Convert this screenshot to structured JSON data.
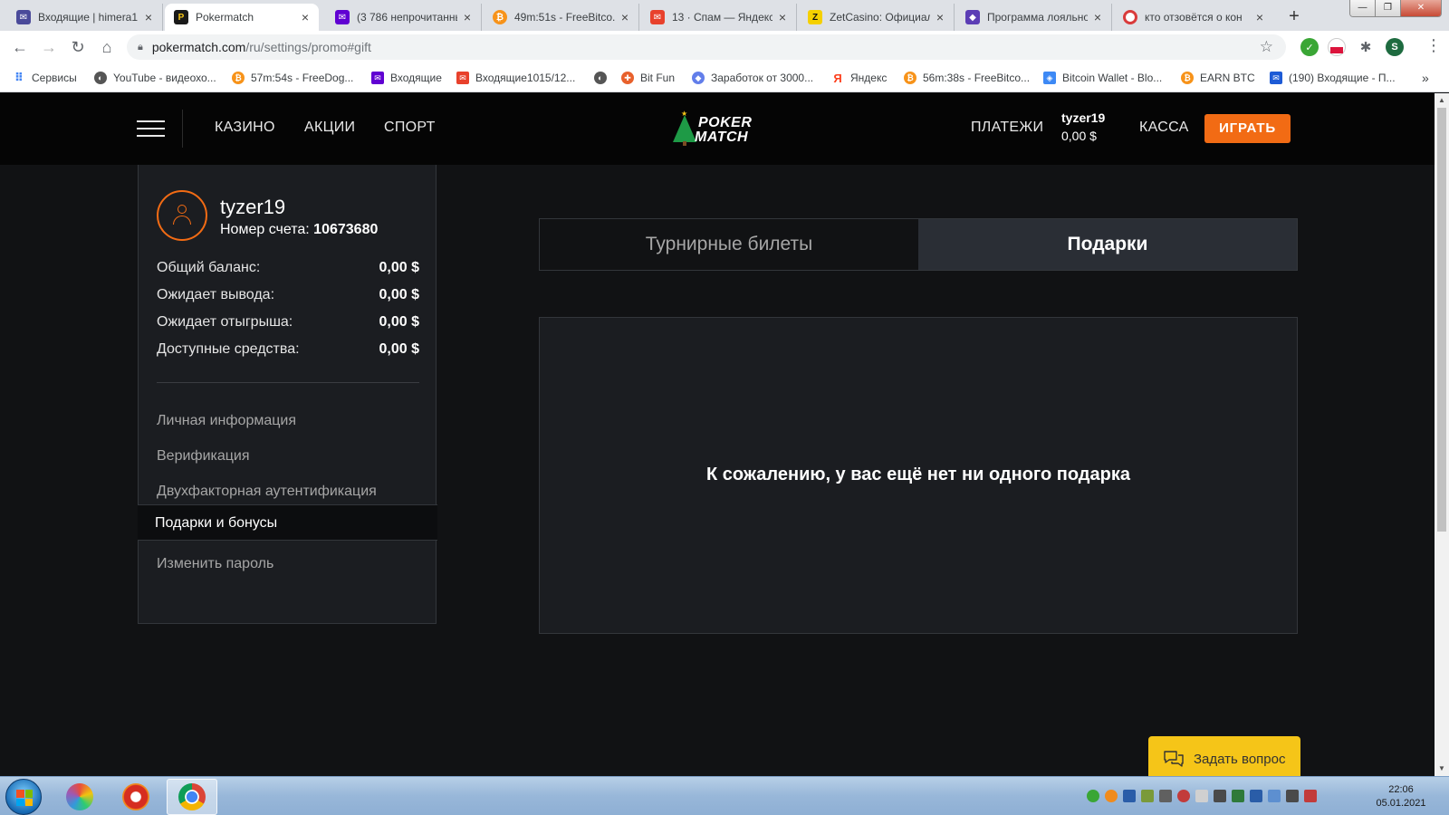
{
  "browser": {
    "tabs": [
      {
        "title": "Входящие | himera1",
        "icon": "mail-icon",
        "color": "#4a4a9a",
        "active": false
      },
      {
        "title": "Pokermatch",
        "icon": "pokermatch-icon",
        "color": "#f5c518",
        "active": true
      },
      {
        "title": "(3 786 непрочитанных",
        "icon": "yahoo-mail-icon",
        "color": "#6001d2",
        "active": false
      },
      {
        "title": "49m:51s - FreeBitco.i",
        "icon": "bitcoin-icon",
        "color": "#f7931a",
        "active": false
      },
      {
        "title": "13 · Спам — Яндекс",
        "icon": "yandex-mail-icon",
        "color": "#e8412c",
        "active": false
      },
      {
        "title": "ZetCasino: Официал",
        "icon": "zetcasino-icon",
        "color": "#f5d000",
        "active": false
      },
      {
        "title": "Программа лояльно",
        "icon": "layers-icon",
        "color": "#5b3db5",
        "active": false
      },
      {
        "title": "кто отзовётся о кон",
        "icon": "lifebuoy-icon",
        "color": "#d93b3b",
        "active": false
      }
    ],
    "new_tab": "+",
    "url_host": "pokermatch.com",
    "url_path": "/ru/settings/promo#gift",
    "profile_initial": "S",
    "bookmarks": [
      {
        "label": "Сервисы",
        "icon": "apps-grid-icon",
        "color": "#4285f4"
      },
      {
        "label": "YouTube - видеохо...",
        "icon": "globe-icon",
        "color": "#555555"
      },
      {
        "label": "57m:54s - FreeDog...",
        "icon": "bitcoin-icon",
        "color": "#f7931a"
      },
      {
        "label": "Входящие",
        "icon": "yahoo-mail-icon",
        "color": "#6001d2"
      },
      {
        "label": "Входящие1015/12...",
        "icon": "yandex-mail-icon",
        "color": "#e8412c"
      },
      {
        "label": "",
        "icon": "globe-icon",
        "color": "#555555"
      },
      {
        "label": "Bit Fun",
        "icon": "bitfun-icon",
        "color": "#e8612c"
      },
      {
        "label": "Заработок от 3000...",
        "icon": "ethereum-icon",
        "color": "#627eea"
      },
      {
        "label": "Яндекс",
        "icon": "yandex-icon",
        "color": "#fc3f1d"
      },
      {
        "label": "56m:38s - FreeBitco...",
        "icon": "bitcoin-icon",
        "color": "#f7931a"
      },
      {
        "label": "Bitcoin Wallet - Blo...",
        "icon": "blockchain-icon",
        "color": "#3d89f5"
      },
      {
        "label": "EARN BTC",
        "icon": "bitcoin-icon",
        "color": "#f7931a"
      },
      {
        "label": "(190) Входящие - П...",
        "icon": "mail-icon",
        "color": "#1d5bd6"
      }
    ],
    "bookmarks_overflow": "»"
  },
  "site": {
    "nav": {
      "casino": "КАЗИНО",
      "promos": "АКЦИИ",
      "sport": "СПОРТ"
    },
    "logo": {
      "line1": "POKER",
      "line2": "MATCH"
    },
    "payments": "ПЛАТЕЖИ",
    "user": {
      "name": "tyzer19",
      "balance": "0,00 $"
    },
    "cashier": "КАССА",
    "play": "ИГРАТЬ",
    "brand_color": "#f26b14"
  },
  "sidebar": {
    "username": "tyzer19",
    "account_label": "Номер счета:",
    "account_number": "10673680",
    "balances": [
      {
        "label": "Общий баланс:",
        "value": "0,00 $"
      },
      {
        "label": "Ожидает вывода:",
        "value": "0,00 $"
      },
      {
        "label": "Ожидает отыгрыша:",
        "value": "0,00 $"
      },
      {
        "label": "Доступные средства:",
        "value": "0,00 $"
      }
    ],
    "menu": [
      {
        "label": "Личная информация",
        "active": false
      },
      {
        "label": "Верификация",
        "active": false
      },
      {
        "label": "Двухфакторная аутентификация",
        "active": false
      },
      {
        "label": "Подарки и бонусы",
        "active": true
      },
      {
        "label": "Изменить пароль",
        "active": false
      }
    ]
  },
  "main": {
    "tabs": [
      {
        "label": "Турнирные билеты",
        "active": false
      },
      {
        "label": "Подарки",
        "active": true
      }
    ],
    "empty_message": "К сожалению, у вас ещё нет ни одного подарка"
  },
  "support": {
    "label": "Задать вопрос"
  },
  "taskbar": {
    "time": "22:06",
    "date": "05.01.2021"
  }
}
